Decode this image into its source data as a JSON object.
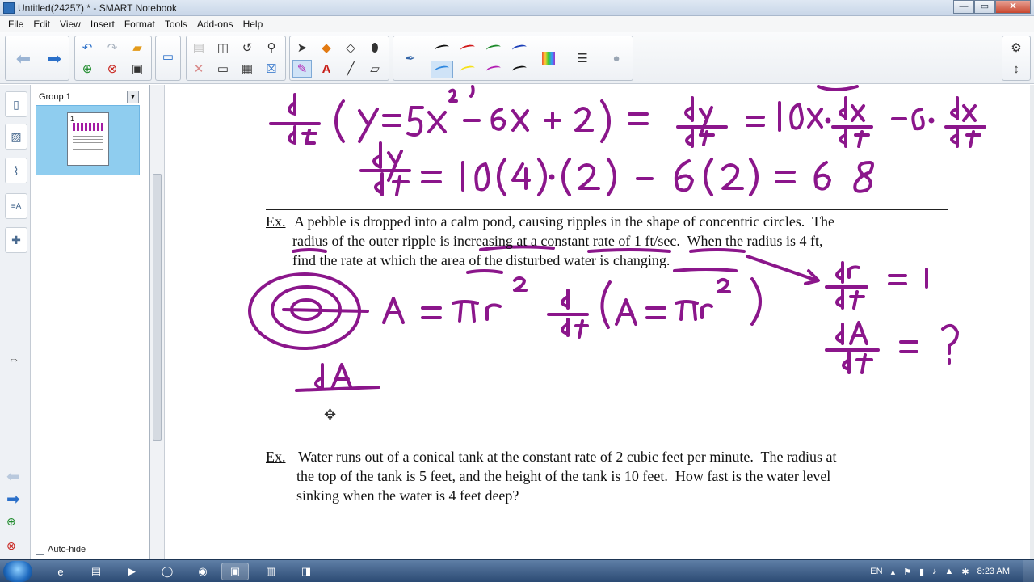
{
  "window": {
    "title": "Untitled(24257) * - SMART Notebook",
    "controls": {
      "minimize": "—",
      "maximize": "▭",
      "close": "✕"
    }
  },
  "menu": [
    "File",
    "Edit",
    "View",
    "Insert",
    "Format",
    "Tools",
    "Add-ons",
    "Help"
  ],
  "toolbar": {
    "icons": [
      "back-arrow",
      "forward-arrow",
      "undo",
      "redo",
      "open-folder",
      "add-page",
      "delete-page",
      "save",
      "screen-shade",
      "paste",
      "delete",
      "insert-table",
      "capture",
      "magic",
      "select-arrow",
      "fill",
      "eraser",
      "pen-variants"
    ],
    "pen_colors": [
      "#111111",
      "#d11a1a",
      "#1d8a2a",
      "#1b3fb8",
      "#f6e11a",
      "#b31fb3",
      "#111111"
    ],
    "highlight_color": "#2f88e0"
  },
  "sorter": {
    "group_label": "Group 1",
    "page_number": "1",
    "autohide_label": "Auto-hide"
  },
  "problem1": {
    "label": "Ex.",
    "lines": [
      "A pebble is dropped into a calm pond, causing ripples in the shape of concentric circles.  The",
      "radius of the outer ripple is increasing at a constant rate of 1 ft/sec.  When the radius is 4 ft,",
      "find the rate at which the area of the disturbed water is changing."
    ]
  },
  "problem2": {
    "label": "Ex.",
    "lines": [
      "Water runs out of a conical tank at the constant rate of 2 cubic feet per minute.  The radius at",
      "the top of the tank is 5 feet, and the height of the tank is 10 feet.  How fast is the water level",
      "sinking when the water is 4 feet deep?"
    ]
  },
  "ink": {
    "color": "#8b168b",
    "line1": "d/dt ( y=5x² −6x +2 ) = dy/dt = 10x · dx/dt − 6 · dx/dt",
    "line2": "dy/dt = 10(4)·(2) − 6(2) = 68",
    "eq_area": "A = πr²",
    "deriv_area": "d/dt ( A = πr² )",
    "drdt": "dr/dt = 1",
    "dAdt": "dA/dt = ?",
    "dA_partial": "dA"
  },
  "taskbar": {
    "language": "EN",
    "clock": "8:23 AM"
  }
}
